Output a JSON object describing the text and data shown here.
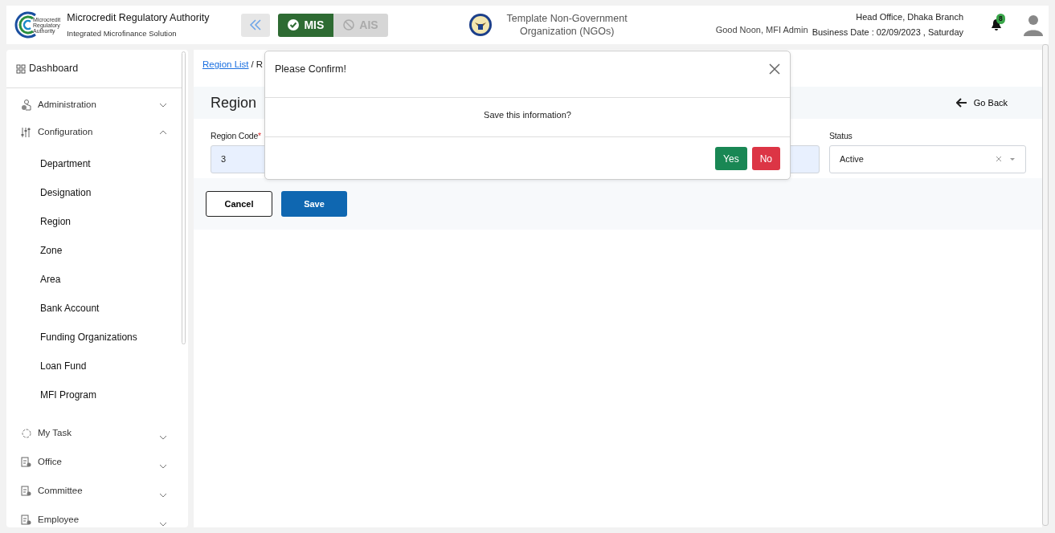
{
  "header": {
    "logo_text": [
      "Microcredit",
      "Regulatory",
      "Authority"
    ],
    "title": "Microcredit Regulatory Authority",
    "subtitle": "Integrated Microfinance Solution",
    "modes": [
      {
        "label": "MIS",
        "selected": true
      },
      {
        "label": "AIS",
        "selected": false
      }
    ],
    "org_name": "Template Non-Government Organization (NGOs)",
    "greeting": "Good Noon, MFI Admin",
    "branch": "Head Office, Dhaka Branch",
    "business_date": "Business Date : 02/09/2023 , Saturday",
    "notification_count": "8"
  },
  "sidebar": {
    "dashboard": "Dashboard",
    "items": [
      {
        "label": "Administration",
        "expanded": false
      },
      {
        "label": "Configuration",
        "expanded": true,
        "children": [
          {
            "label": "Department"
          },
          {
            "label": "Designation"
          },
          {
            "label": "Region"
          },
          {
            "label": "Zone"
          },
          {
            "label": "Area"
          },
          {
            "label": "Bank Account"
          },
          {
            "label": "Funding Organizations"
          },
          {
            "label": "Loan Fund"
          },
          {
            "label": "MFI Program"
          }
        ]
      },
      {
        "label": "My Task",
        "expanded": false
      },
      {
        "label": "Office",
        "expanded": false
      },
      {
        "label": "Committee",
        "expanded": false
      },
      {
        "label": "Employee",
        "expanded": false
      }
    ]
  },
  "breadcrumb": [
    {
      "label": "Region List",
      "kind": "link"
    },
    {
      "label": "/",
      "kind": "separator"
    },
    {
      "label": "R",
      "kind": "text"
    }
  ],
  "page_title": "Region",
  "go_back": "Go Back",
  "fields": [
    {
      "kind": "input",
      "label": "Region Code",
      "required_mark": "*",
      "value": "3"
    },
    {
      "kind": "select",
      "label": "Status",
      "value": "Active"
    }
  ],
  "buttons": [
    {
      "label": "Cancel",
      "kind": "outline"
    },
    {
      "label": "Save",
      "kind": "primary"
    }
  ],
  "modal": {
    "title": "Please Confirm!",
    "message": "Save this information?",
    "buttons": [
      {
        "label": "Yes",
        "kind": "success"
      },
      {
        "label": "No",
        "kind": "danger"
      }
    ]
  }
}
